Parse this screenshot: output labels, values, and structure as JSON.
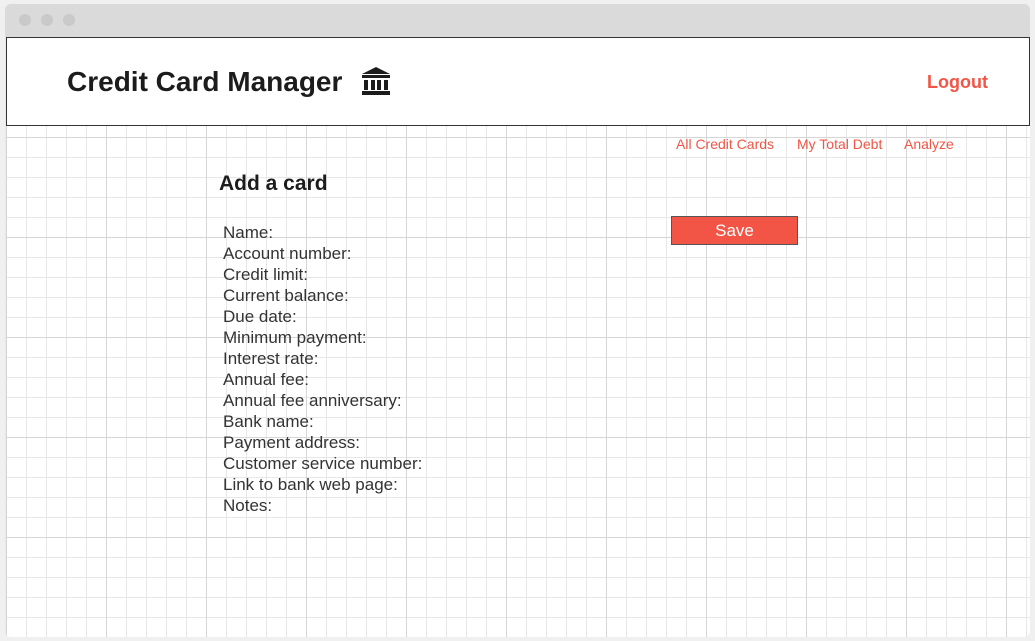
{
  "app": {
    "title": "Credit Card Manager",
    "title_icon": "bank-icon",
    "logout_label": "Logout"
  },
  "nav": {
    "items": [
      {
        "label": "All Credit Cards"
      },
      {
        "label": "My Total Debt"
      },
      {
        "label": "Analyze"
      }
    ]
  },
  "form": {
    "title": "Add a card",
    "fields": [
      {
        "label": "Name:"
      },
      {
        "label": "Account number:"
      },
      {
        "label": "Credit limit:"
      },
      {
        "label": "Current balance:"
      },
      {
        "label": "Due date:"
      },
      {
        "label": "Minimum payment:"
      },
      {
        "label": "Interest rate:"
      },
      {
        "label": "Annual fee:"
      },
      {
        "label": "Annual fee anniversary:"
      },
      {
        "label": "Bank name:"
      },
      {
        "label": "Payment address:"
      },
      {
        "label": "Customer service number:"
      },
      {
        "label": "Link to bank web page:"
      },
      {
        "label": "Notes:"
      }
    ],
    "save_label": "Save"
  },
  "colors": {
    "accent": "#f25545",
    "text": "#1c1c1c"
  }
}
